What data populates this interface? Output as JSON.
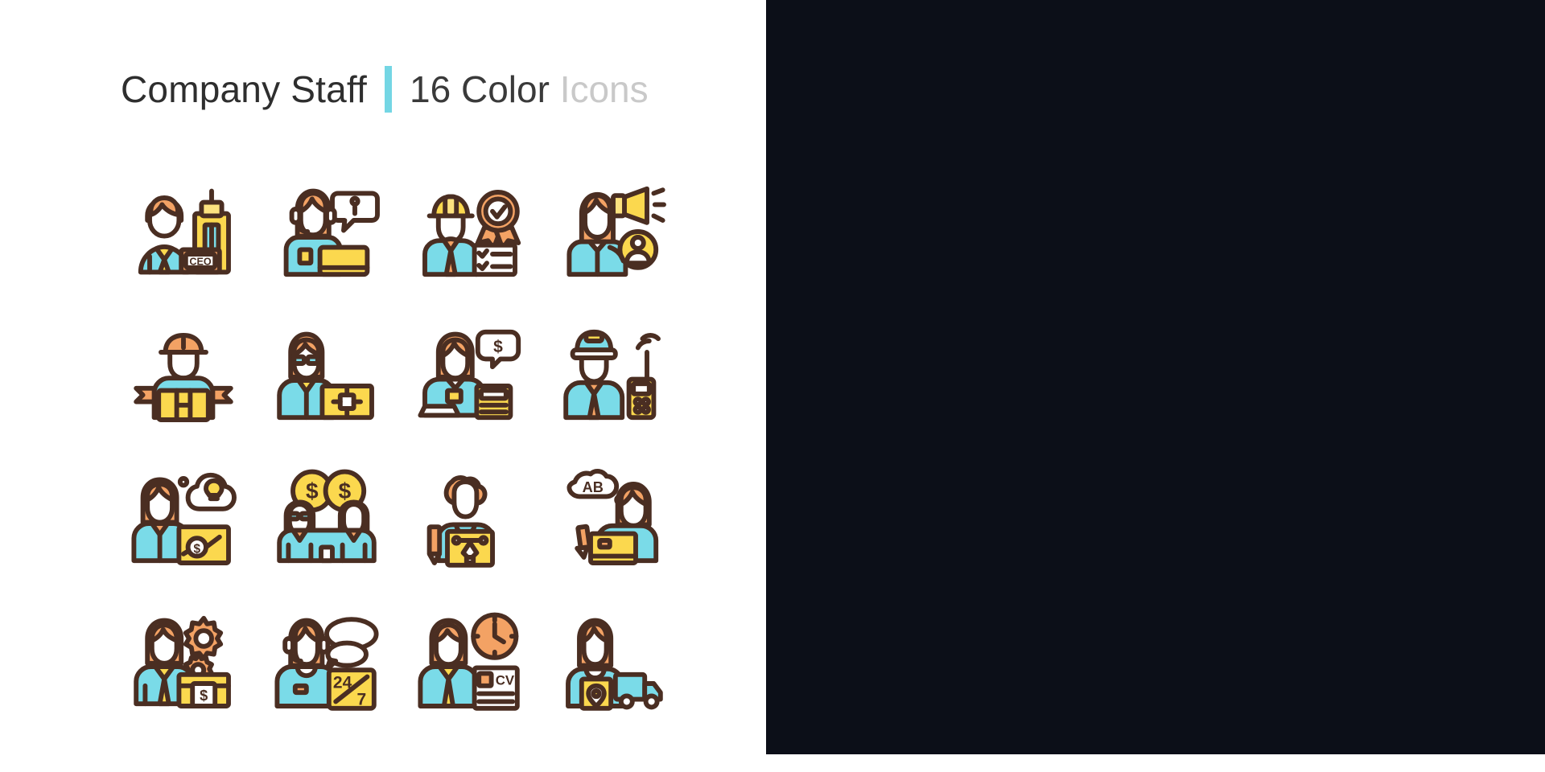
{
  "header": {
    "title": "Company Staff",
    "subtitle_count": "16 Color",
    "subtitle_word": "Icons",
    "divider_color": "#74d6e4"
  },
  "palette": {
    "outline": "#4a2e22",
    "cyan": "#7adbe8",
    "yellow": "#fbd84e",
    "orange": "#f3a264",
    "white": "#ffffff",
    "dark_background": "#0c0f18",
    "light_background": "#ffffff",
    "muted_text": "#c9c9c9"
  },
  "icon_labels": {
    "ceo": "CEO",
    "info": "i",
    "dollar": "$",
    "money_coin": "$",
    "briefcase_dollar": "$",
    "support_hours": "24/7",
    "support_hours_top": "24",
    "support_hours_bottom": "7",
    "resume": "CV",
    "translate": "AB"
  },
  "icons": [
    {
      "id": "ceo-executive",
      "name": "ceo-executive-icon",
      "row": 1,
      "col": 1,
      "label": "CEO"
    },
    {
      "id": "call-center-agent",
      "name": "call-center-agent-icon",
      "row": 1,
      "col": 2,
      "label": "i"
    },
    {
      "id": "quality-engineer",
      "name": "quality-engineer-icon",
      "row": 1,
      "col": 3,
      "label": ""
    },
    {
      "id": "marketing-promoter",
      "name": "marketing-promoter-icon",
      "row": 1,
      "col": 4,
      "label": ""
    },
    {
      "id": "delivery-courier",
      "name": "delivery-courier-icon",
      "row": 2,
      "col": 1,
      "label": ""
    },
    {
      "id": "it-technician",
      "name": "it-technician-icon",
      "row": 2,
      "col": 2,
      "label": ""
    },
    {
      "id": "accountant",
      "name": "accountant-icon",
      "row": 2,
      "col": 3,
      "label": "$"
    },
    {
      "id": "security-guard",
      "name": "security-guard-icon",
      "row": 2,
      "col": 4,
      "label": ""
    },
    {
      "id": "business-analyst",
      "name": "business-analyst-icon",
      "row": 3,
      "col": 1,
      "label": "$"
    },
    {
      "id": "investors-pair",
      "name": "investors-pair-icon",
      "row": 3,
      "col": 2,
      "label": "$"
    },
    {
      "id": "graphic-designer",
      "name": "graphic-designer-icon",
      "row": 3,
      "col": 3,
      "label": ""
    },
    {
      "id": "translator",
      "name": "translator-icon",
      "row": 3,
      "col": 4,
      "label": "AB"
    },
    {
      "id": "hr-manager",
      "name": "hr-manager-icon",
      "row": 4,
      "col": 1,
      "label": "$"
    },
    {
      "id": "support-24-7",
      "name": "support-24-7-icon",
      "row": 4,
      "col": 2,
      "label": "24/7"
    },
    {
      "id": "recruiter",
      "name": "recruiter-icon",
      "row": 4,
      "col": 3,
      "label": "CV"
    },
    {
      "id": "logistics-manager",
      "name": "logistics-manager-icon",
      "row": 4,
      "col": 4,
      "label": ""
    }
  ],
  "themes": [
    {
      "id": "light",
      "name": "light-theme-panel"
    },
    {
      "id": "dark",
      "name": "dark-theme-panel"
    }
  ]
}
